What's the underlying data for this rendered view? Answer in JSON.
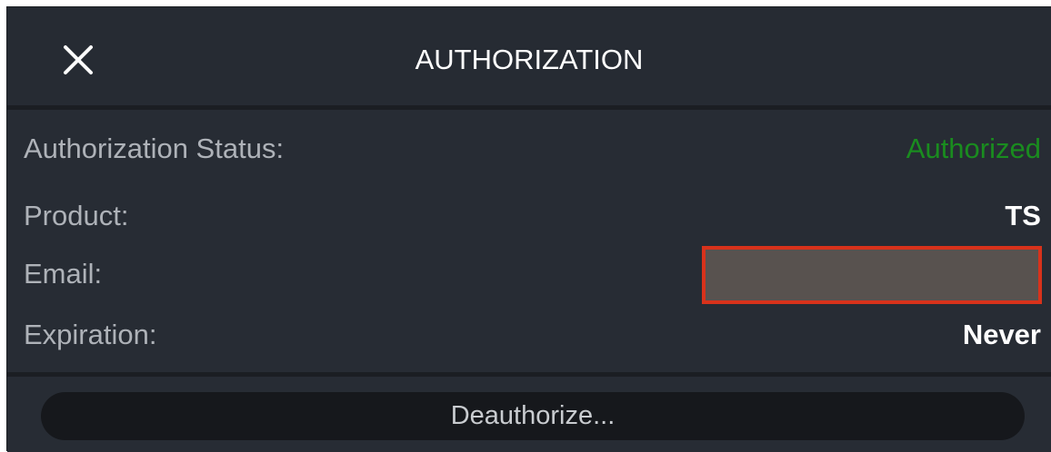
{
  "header": {
    "title": "AUTHORIZATION",
    "close_icon": "close-icon"
  },
  "details": {
    "status": {
      "label": "Authorization Status:",
      "value": "Authorized",
      "value_color": "#1a8c1f"
    },
    "product": {
      "label": "Product:",
      "value": "TS"
    },
    "email": {
      "label": "Email:",
      "value": "",
      "redaction_border_color": "#d8321b",
      "redaction_fill_color": "#58524f"
    },
    "expiration": {
      "label": "Expiration:",
      "value": "Never"
    }
  },
  "footer": {
    "deauthorize_label": "Deauthorize..."
  },
  "colors": {
    "background": "#272c34",
    "divider": "#1b1e23",
    "button": "#16181c"
  }
}
